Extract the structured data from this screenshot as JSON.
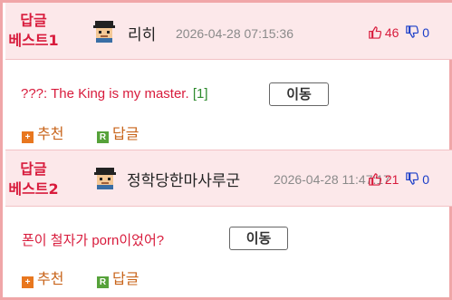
{
  "comments": [
    {
      "best_label_1": "답글",
      "best_label_2": "베스트1",
      "author": "리히",
      "date": "2026-04-28 07:15:36",
      "up_count": "46",
      "down_count": "0",
      "text": "???: The King is my master.",
      "reply_count": "[1]",
      "move_button": "이동",
      "recommend_label": "추천",
      "reply_label": "답글"
    },
    {
      "best_label_1": "답글",
      "best_label_2": "베스트2",
      "author": "정학당한마사루군",
      "date": "2026-04-28 11:47:17",
      "up_count": "21",
      "down_count": "0",
      "text": "폰이 철자가 porn이었어?",
      "move_button": "이동",
      "recommend_label": "추천",
      "reply_label": "답글"
    }
  ],
  "colors": {
    "accent_red": "#d81b3c",
    "header_bg": "#fce8ea",
    "border_pink": "#f0a6a8",
    "reply_count_green": "#2e8b2e",
    "downvote_blue": "#1a3dc8",
    "recommend_orange": "#e8771f",
    "reply_icon_green": "#56a23a"
  },
  "icons": [
    "avatar",
    "thumbs-up-icon",
    "thumbs-down-icon",
    "plus-icon",
    "reply-r-icon"
  ]
}
